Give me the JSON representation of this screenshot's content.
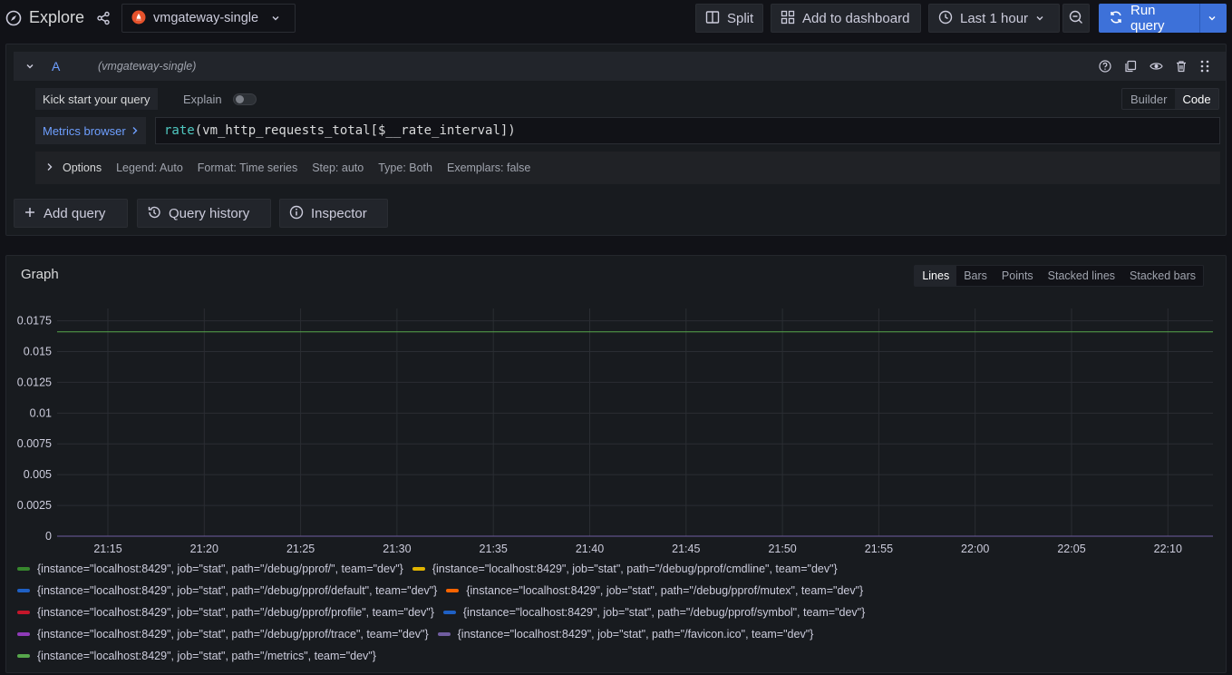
{
  "topbar": {
    "title": "Explore",
    "datasource": "vmgateway-single",
    "split_label": "Split",
    "add_dashboard_label": "Add to dashboard",
    "time_range": "Last 1 hour",
    "run_label": "Run query"
  },
  "query": {
    "ref_id": "A",
    "datasource_hint": "(vmgateway-single)",
    "kick_start": "Kick start your query",
    "explain": "Explain",
    "builder": "Builder",
    "code": "Code",
    "metrics_browser": "Metrics browser",
    "fn": "rate",
    "expr_rest": "(vm_http_requests_total[$__rate_interval])",
    "options": {
      "label": "Options",
      "legend": "Legend: Auto",
      "format": "Format: Time series",
      "step": "Step: auto",
      "type": "Type: Both",
      "exemplars": "Exemplars: false"
    }
  },
  "actions": {
    "add_query": "Add query",
    "query_history": "Query history",
    "inspector": "Inspector"
  },
  "graph": {
    "title": "Graph",
    "modes": [
      "Lines",
      "Bars",
      "Points",
      "Stacked lines",
      "Stacked bars"
    ],
    "active_mode": "Lines"
  },
  "colors": {
    "accent": "#3d71d9",
    "series_high": "#73bf69",
    "series_low": "#8f3bb8"
  },
  "chart_data": {
    "type": "line",
    "x": [
      "21:15",
      "21:20",
      "21:25",
      "21:30",
      "21:35",
      "21:40",
      "21:45",
      "21:50",
      "21:55",
      "22:00",
      "22:05",
      "22:10"
    ],
    "yticks": [
      "0.0175",
      "0.015",
      "0.0125",
      "0.01",
      "0.0075",
      "0.005",
      "0.0025",
      "0"
    ],
    "ylim": [
      0,
      0.0185
    ],
    "grid": true,
    "legend_position": "bottom",
    "series": [
      {
        "name": "{instance=\"localhost:8429\", job=\"stat\", path=\"/debug/pprof/\", team=\"dev\"}",
        "color": "#37872d",
        "value": 0
      },
      {
        "name": "{instance=\"localhost:8429\", job=\"stat\", path=\"/debug/pprof/cmdline\", team=\"dev\"}",
        "color": "#e0b400",
        "value": 0
      },
      {
        "name": "{instance=\"localhost:8429\", job=\"stat\", path=\"/debug/pprof/default\", team=\"dev\"}",
        "color": "#1f60c4",
        "value": 0
      },
      {
        "name": "{instance=\"localhost:8429\", job=\"stat\", path=\"/debug/pprof/mutex\", team=\"dev\"}",
        "color": "#fa6400",
        "value": 0
      },
      {
        "name": "{instance=\"localhost:8429\", job=\"stat\", path=\"/debug/pprof/profile\", team=\"dev\"}",
        "color": "#c4162a",
        "value": 0
      },
      {
        "name": "{instance=\"localhost:8429\", job=\"stat\", path=\"/debug/pprof/symbol\", team=\"dev\"}",
        "color": "#1f60c4",
        "value": 0
      },
      {
        "name": "{instance=\"localhost:8429\", job=\"stat\", path=\"/debug/pprof/trace\", team=\"dev\"}",
        "color": "#8f3bb8",
        "value": 0
      },
      {
        "name": "{instance=\"localhost:8429\", job=\"stat\", path=\"/favicon.ico\", team=\"dev\"}",
        "color": "#705da0",
        "value": 0
      },
      {
        "name": "{instance=\"localhost:8429\", job=\"stat\", path=\"/metrics\", team=\"dev\"}",
        "color": "#56a64b",
        "value": 0.0166
      }
    ]
  }
}
